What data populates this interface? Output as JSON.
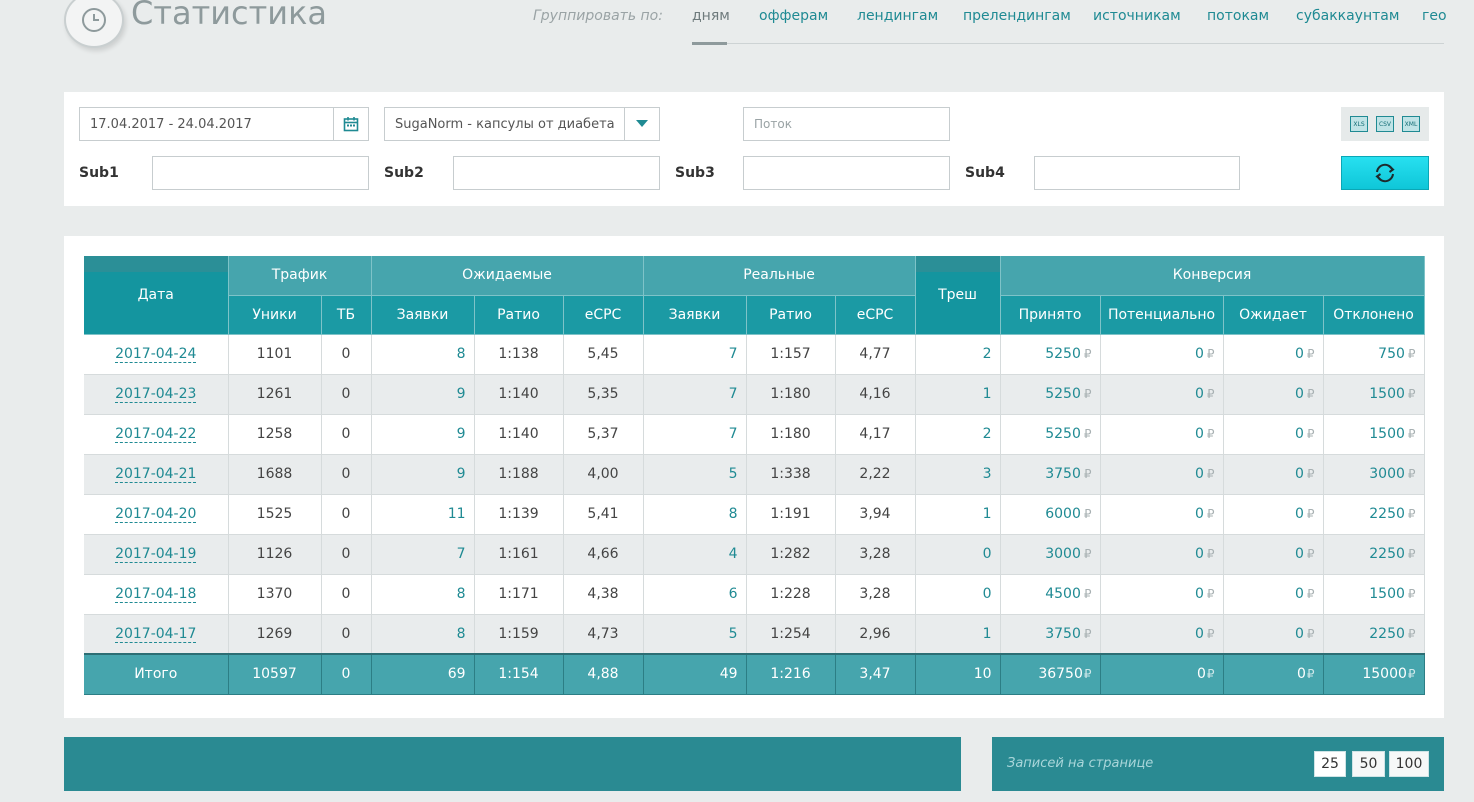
{
  "header": {
    "title": "Статистика",
    "group_label": "Группировать по:",
    "group_tabs": [
      "дням",
      "офферам",
      "лендингам",
      "прелендингам",
      "источникам",
      "потокам",
      "субаккаунтам",
      "гео"
    ],
    "active_tab": "дням"
  },
  "filters": {
    "date_range": "17.04.2017 - 24.04.2017",
    "offer": "SugaNorm - капсулы от диабета",
    "flow_placeholder": "Поток",
    "sub1_label": "Sub1",
    "sub2_label": "Sub2",
    "sub3_label": "Sub3",
    "sub4_label": "Sub4",
    "export": [
      "XLS",
      "CSV",
      "XML"
    ]
  },
  "colors": {
    "accent": "#1f8a93",
    "header": "#46a5ad",
    "refresh": "#1fd4e6"
  },
  "table": {
    "groups": {
      "date": "Дата",
      "traffic": "Трафик",
      "expected": "Ожидаемые",
      "real": "Реальные",
      "trash": "Треш",
      "conversion": "Конверсия"
    },
    "subheaders": {
      "uniques": "Уники",
      "tb": "ТБ",
      "exp_orders": "Заявки",
      "exp_ratio": "Ратио",
      "exp_ecpc": "eCPC",
      "real_orders": "Заявки",
      "real_ratio": "Ратио",
      "real_ecpc": "eCPC",
      "accepted": "Принято",
      "potential": "Потенциально",
      "pending": "Ожидает",
      "rejected": "Отклонено"
    },
    "currency": "₽",
    "rows": [
      {
        "date": "2017-04-24",
        "uniques": "1101",
        "tb": "0",
        "exp_orders": "8",
        "exp_ratio": "1:138",
        "exp_ecpc": "5,45",
        "real_orders": "7",
        "real_ratio": "1:157",
        "real_ecpc": "4,77",
        "trash": "2",
        "accepted": "5250",
        "potential": "0",
        "pending": "0",
        "rejected": "750"
      },
      {
        "date": "2017-04-23",
        "uniques": "1261",
        "tb": "0",
        "exp_orders": "9",
        "exp_ratio": "1:140",
        "exp_ecpc": "5,35",
        "real_orders": "7",
        "real_ratio": "1:180",
        "real_ecpc": "4,16",
        "trash": "1",
        "accepted": "5250",
        "potential": "0",
        "pending": "0",
        "rejected": "1500"
      },
      {
        "date": "2017-04-22",
        "uniques": "1258",
        "tb": "0",
        "exp_orders": "9",
        "exp_ratio": "1:140",
        "exp_ecpc": "5,37",
        "real_orders": "7",
        "real_ratio": "1:180",
        "real_ecpc": "4,17",
        "trash": "2",
        "accepted": "5250",
        "potential": "0",
        "pending": "0",
        "rejected": "1500"
      },
      {
        "date": "2017-04-21",
        "uniques": "1688",
        "tb": "0",
        "exp_orders": "9",
        "exp_ratio": "1:188",
        "exp_ecpc": "4,00",
        "real_orders": "5",
        "real_ratio": "1:338",
        "real_ecpc": "2,22",
        "trash": "3",
        "accepted": "3750",
        "potential": "0",
        "pending": "0",
        "rejected": "3000"
      },
      {
        "date": "2017-04-20",
        "uniques": "1525",
        "tb": "0",
        "exp_orders": "11",
        "exp_ratio": "1:139",
        "exp_ecpc": "5,41",
        "real_orders": "8",
        "real_ratio": "1:191",
        "real_ecpc": "3,94",
        "trash": "1",
        "accepted": "6000",
        "potential": "0",
        "pending": "0",
        "rejected": "2250"
      },
      {
        "date": "2017-04-19",
        "uniques": "1126",
        "tb": "0",
        "exp_orders": "7",
        "exp_ratio": "1:161",
        "exp_ecpc": "4,66",
        "real_orders": "4",
        "real_ratio": "1:282",
        "real_ecpc": "3,28",
        "trash": "0",
        "accepted": "3000",
        "potential": "0",
        "pending": "0",
        "rejected": "2250"
      },
      {
        "date": "2017-04-18",
        "uniques": "1370",
        "tb": "0",
        "exp_orders": "8",
        "exp_ratio": "1:171",
        "exp_ecpc": "4,38",
        "real_orders": "6",
        "real_ratio": "1:228",
        "real_ecpc": "3,28",
        "trash": "0",
        "accepted": "4500",
        "potential": "0",
        "pending": "0",
        "rejected": "1500"
      },
      {
        "date": "2017-04-17",
        "uniques": "1269",
        "tb": "0",
        "exp_orders": "8",
        "exp_ratio": "1:159",
        "exp_ecpc": "4,73",
        "real_orders": "5",
        "real_ratio": "1:254",
        "real_ecpc": "2,96",
        "trash": "1",
        "accepted": "3750",
        "potential": "0",
        "pending": "0",
        "rejected": "2250"
      }
    ],
    "total": {
      "label": "Итого",
      "uniques": "10597",
      "tb": "0",
      "exp_orders": "69",
      "exp_ratio": "1:154",
      "exp_ecpc": "4,88",
      "real_orders": "49",
      "real_ratio": "1:216",
      "real_ecpc": "3,47",
      "trash": "10",
      "accepted": "36750",
      "potential": "0",
      "pending": "0",
      "rejected": "15000"
    }
  },
  "pagination": {
    "per_page_label": "Записей на странице",
    "options": [
      "25",
      "50",
      "100"
    ],
    "selected": "25"
  }
}
